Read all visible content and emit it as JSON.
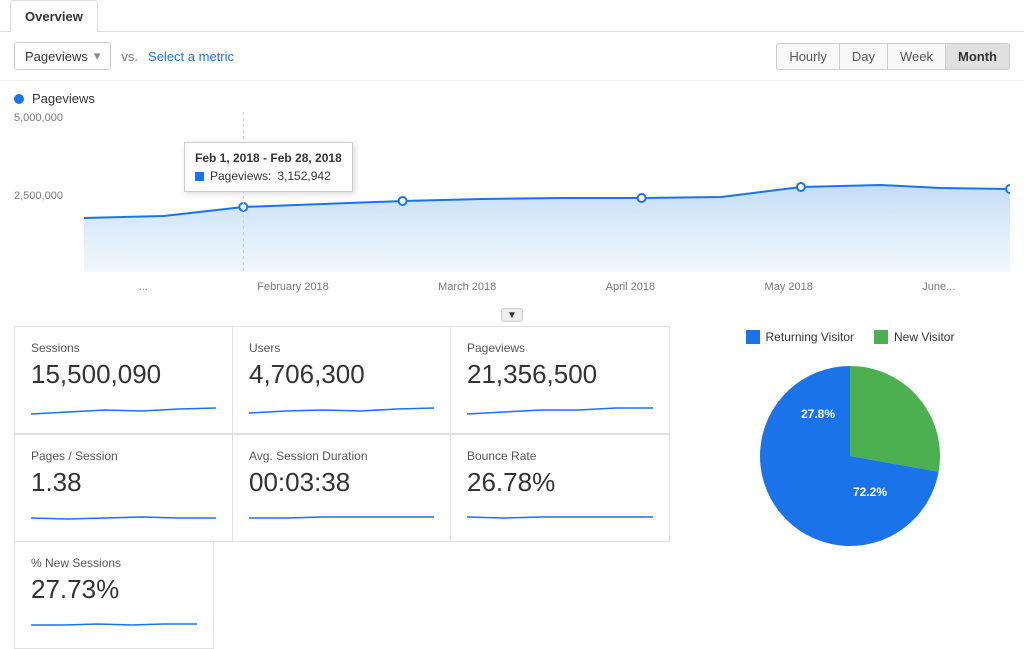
{
  "tabs": [
    {
      "id": "overview",
      "label": "Overview",
      "active": true
    }
  ],
  "toolbar": {
    "metric_dropdown_label": "Pageviews",
    "vs_label": "vs.",
    "select_metric_label": "Select a metric",
    "period_buttons": [
      {
        "id": "hourly",
        "label": "Hourly",
        "active": false
      },
      {
        "id": "day",
        "label": "Day",
        "active": false
      },
      {
        "id": "week",
        "label": "Week",
        "active": false
      },
      {
        "id": "month",
        "label": "Month",
        "active": true
      }
    ]
  },
  "chart": {
    "legend_label": "Pageviews",
    "y_labels": [
      "5,000,000",
      "2,500,000"
    ],
    "x_labels": [
      "...",
      "February 2018",
      "March 2018",
      "April 2018",
      "May 2018",
      "June..."
    ],
    "tooltip": {
      "title": "Feb 1, 2018 - Feb 28, 2018",
      "metric_label": "Pageviews:",
      "metric_value": "3,152,942"
    }
  },
  "metrics": [
    {
      "id": "sessions",
      "label": "Sessions",
      "value": "15,500,090"
    },
    {
      "id": "users",
      "label": "Users",
      "value": "4,706,300"
    },
    {
      "id": "pageviews",
      "label": "Pageviews",
      "value": "21,356,500"
    },
    {
      "id": "pages-per-session",
      "label": "Pages / Session",
      "value": "1.38"
    },
    {
      "id": "avg-session-duration",
      "label": "Avg. Session Duration",
      "value": "00:03:38"
    },
    {
      "id": "bounce-rate",
      "label": "Bounce Rate",
      "value": "26.78%"
    }
  ],
  "bottom_metrics": [
    {
      "id": "new-sessions",
      "label": "% New Sessions",
      "value": "27.73%"
    }
  ],
  "pie_chart": {
    "legend": [
      {
        "id": "returning",
        "label": "Returning Visitor",
        "color": "#1a73e8"
      },
      {
        "id": "new",
        "label": "New Visitor",
        "color": "#4caf50"
      }
    ],
    "slices": [
      {
        "id": "returning",
        "label": "Returning Visitor",
        "value": 72.2,
        "color": "#1a73e8",
        "display": "72.2%"
      },
      {
        "id": "new",
        "label": "New Visitor",
        "value": 27.8,
        "color": "#4caf50",
        "display": "27.8%"
      }
    ]
  },
  "colors": {
    "accent_blue": "#1a73e8",
    "chart_fill": "#b3d4f5",
    "chart_line": "#1a73e8",
    "green": "#4caf50",
    "active_tab_bg": "#fff",
    "month_btn_bg": "#e0e0e0"
  }
}
